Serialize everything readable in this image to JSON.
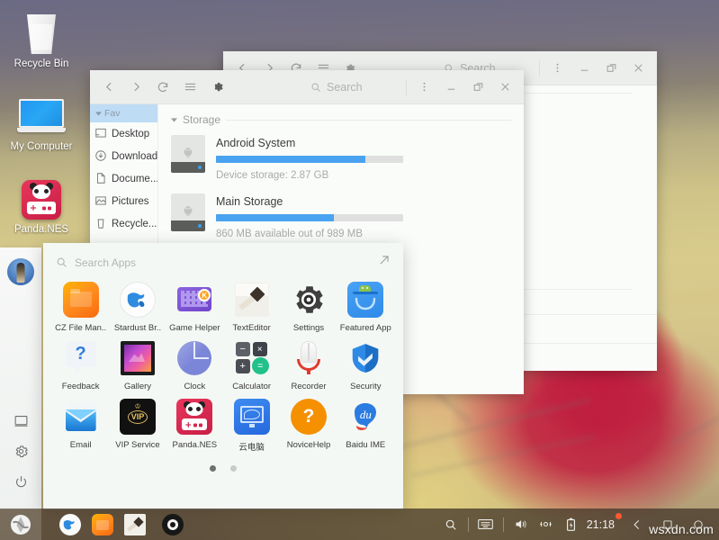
{
  "desktop": {
    "icons": [
      {
        "label": "Recycle Bin",
        "icon": "recycle-bin-icon"
      },
      {
        "label": "My Computer",
        "icon": "my-computer-icon"
      },
      {
        "label": "Panda.NES",
        "icon": "panda-nes-icon"
      }
    ]
  },
  "back_window": {
    "title": "",
    "search_placeholder": "Search",
    "toolbar": {
      "back": "back-arrow",
      "forward": "forward-arrow",
      "refresh": "refresh",
      "menu": "hamburger",
      "settings": "gear",
      "more": "more-vertical",
      "minimize": "minimize",
      "maximize": "maximize",
      "close": "close"
    }
  },
  "file_manager": {
    "search_placeholder": "Search",
    "sidebar": {
      "group_label": "Fav",
      "items": [
        {
          "label": "Desktop",
          "icon": "desktop-icon"
        },
        {
          "label": "Download",
          "icon": "download-icon"
        },
        {
          "label": "Docume...",
          "icon": "document-icon"
        },
        {
          "label": "Pictures",
          "icon": "picture-icon"
        },
        {
          "label": "Recycle...",
          "icon": "recycle-icon"
        }
      ]
    },
    "content": {
      "section_label": "Storage",
      "items": [
        {
          "name": "Android System",
          "sub": "Device storage: 2.87 GB",
          "percent": 80,
          "bar_color": "#4aa3f0"
        },
        {
          "name": "Main Storage",
          "sub": "860 MB available out of 989 MB",
          "percent": 63,
          "bar_color": "#4aa3f0"
        }
      ]
    }
  },
  "app_drawer": {
    "search_placeholder": "Search Apps",
    "expand_icon": "expand-arrow-icon",
    "pages": {
      "count": 2,
      "current": 1
    },
    "apps": [
      {
        "label": "CZ File Man..",
        "icon": "cz-file-manager-icon"
      },
      {
        "label": "Stardust Br..",
        "icon": "stardust-browser-icon"
      },
      {
        "label": "Game Helper",
        "icon": "game-helper-icon"
      },
      {
        "label": "TextEditor",
        "icon": "text-editor-icon"
      },
      {
        "label": "Settings",
        "icon": "settings-gear-icon"
      },
      {
        "label": "Featured App",
        "icon": "featured-app-icon"
      },
      {
        "label": "Feedback",
        "icon": "feedback-icon"
      },
      {
        "label": "Gallery",
        "icon": "gallery-icon"
      },
      {
        "label": "Clock",
        "icon": "clock-icon"
      },
      {
        "label": "Calculator",
        "icon": "calculator-icon"
      },
      {
        "label": "Recorder",
        "icon": "recorder-icon"
      },
      {
        "label": "Security",
        "icon": "security-shield-icon"
      },
      {
        "label": "Email",
        "icon": "email-icon"
      },
      {
        "label": "VIP Service",
        "icon": "vip-service-icon"
      },
      {
        "label": "Panda.NES",
        "icon": "panda-nes-icon"
      },
      {
        "label": "云电脑",
        "icon": "cloud-pc-icon"
      },
      {
        "label": "NoviceHelp",
        "icon": "novice-help-icon"
      },
      {
        "label": "Baidu IME",
        "icon": "baidu-ime-icon"
      }
    ]
  },
  "left_panel": {
    "avatar": "user-avatar",
    "buttons": [
      {
        "icon": "display-icon"
      },
      {
        "icon": "settings-gear-icon"
      },
      {
        "icon": "power-icon"
      }
    ]
  },
  "taskbar": {
    "launcher_icon": "launcher-icon",
    "apps": [
      {
        "icon": "stardust-browser-icon"
      },
      {
        "icon": "cz-file-manager-icon"
      },
      {
        "icon": "text-editor-icon"
      },
      {
        "icon": "recorder-dark-icon"
      }
    ],
    "tray": [
      {
        "icon": "search-icon"
      },
      {
        "icon": "keyboard-icon"
      },
      {
        "icon": "volume-icon"
      },
      {
        "icon": "brightness-icon"
      },
      {
        "icon": "battery-icon"
      }
    ],
    "clock": "21:18",
    "nav": [
      {
        "icon": "nav-back-icon"
      },
      {
        "icon": "nav-home-icon"
      },
      {
        "icon": "nav-recents-icon"
      }
    ]
  },
  "watermark": "wsxdn.com"
}
